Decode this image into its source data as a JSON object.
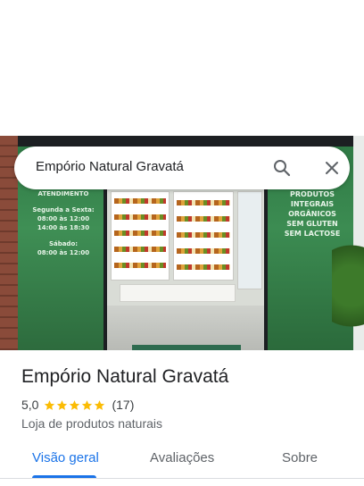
{
  "search": {
    "query": "Empório Natural Gravatá",
    "search_icon": "search-icon",
    "close_icon": "close-icon"
  },
  "photo": {
    "glass_left_lines": [
      "ATENDIMENTO",
      "Segunda a Sexta:",
      "08:00 às 12:00",
      "14:00 às 18:30",
      "Sábado:",
      "08:00 às 12:00"
    ],
    "glass_right_lines": [
      "PRODUTOS",
      "INTEGRAIS",
      "ORGÂNICOS",
      "SEM GLUTEN",
      "SEM LACTOSE"
    ]
  },
  "place": {
    "title": "Empório Natural Gravatá",
    "rating": "5,0",
    "stars": 5,
    "reviews": "(17)",
    "category": "Loja de produtos naturais"
  },
  "tabs": [
    {
      "label": "Visão geral",
      "active": true
    },
    {
      "label": "Avaliações",
      "active": false
    },
    {
      "label": "Sobre",
      "active": false
    }
  ],
  "colors": {
    "accent": "#1a73e8",
    "star": "#fbbc04",
    "text_primary": "#202124",
    "text_secondary": "#5f6368"
  }
}
